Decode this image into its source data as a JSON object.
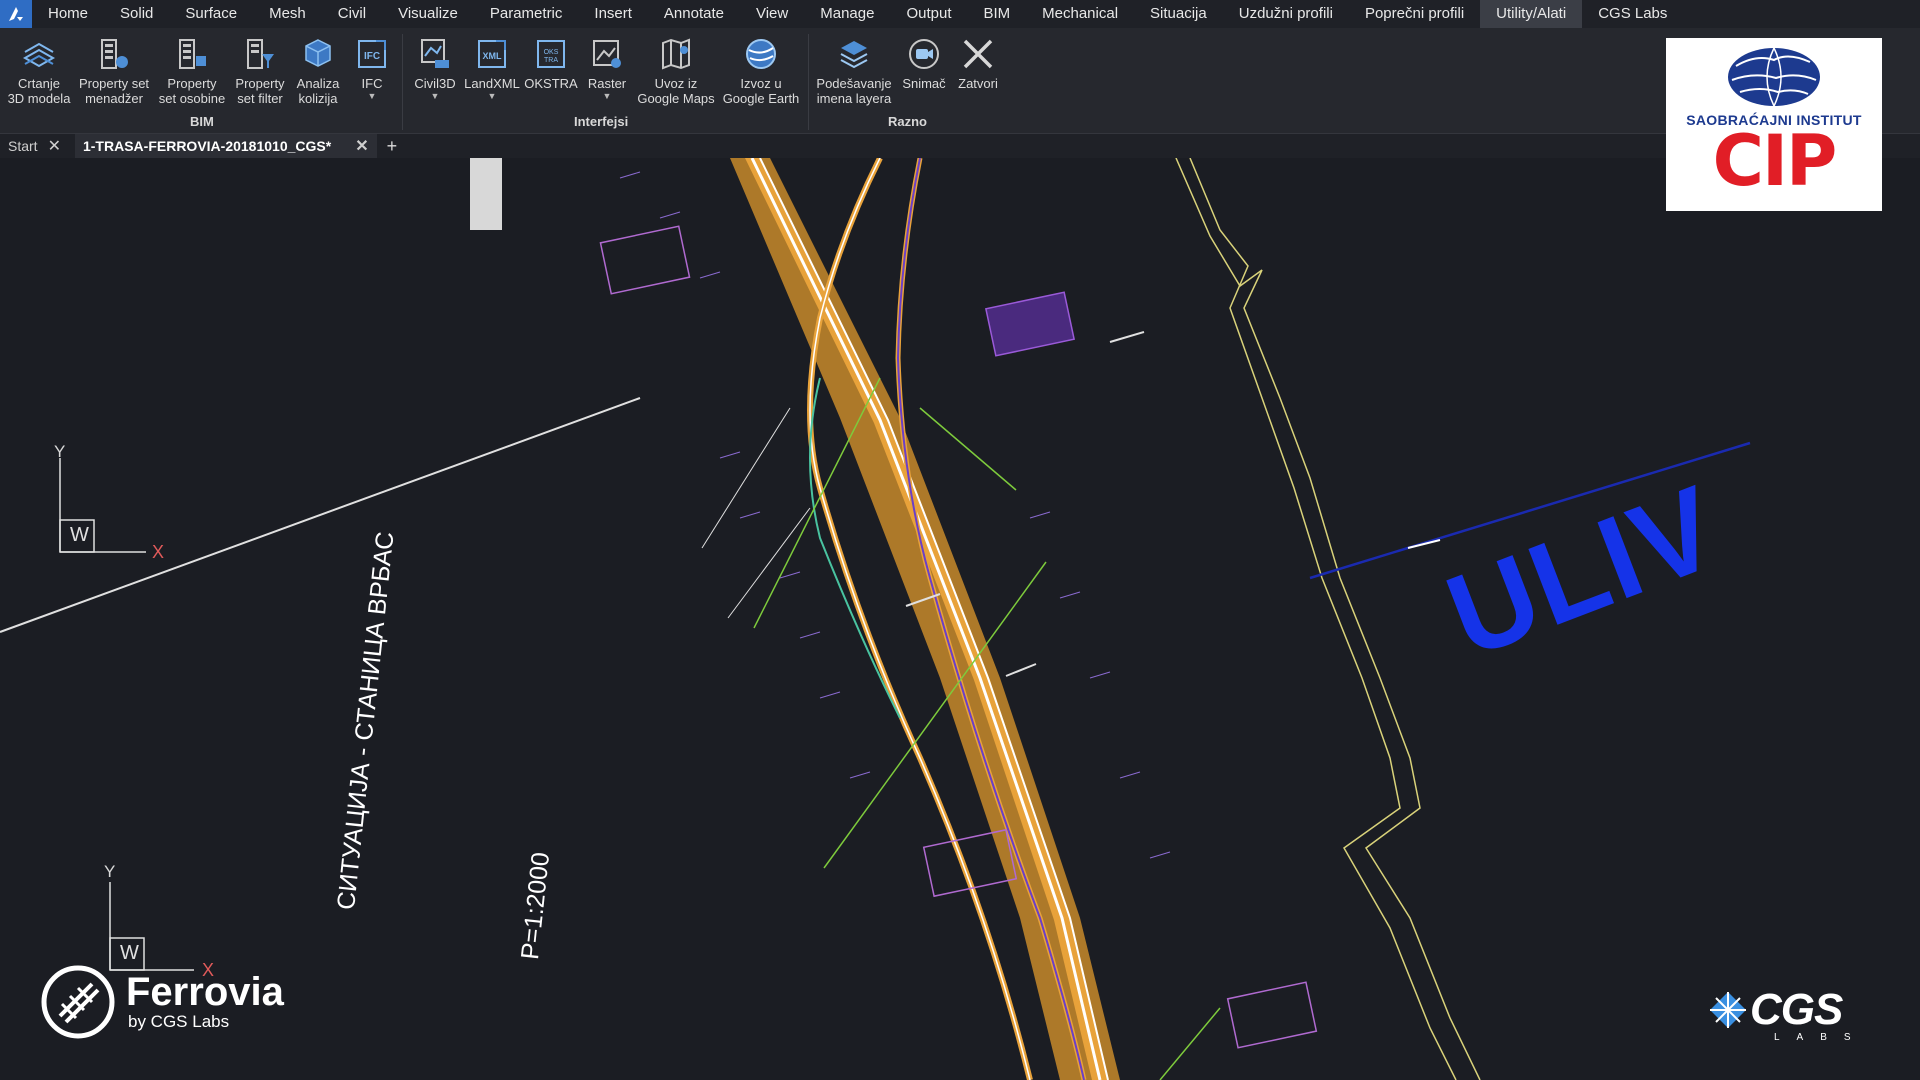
{
  "menu": {
    "items": [
      "Home",
      "Solid",
      "Surface",
      "Mesh",
      "Civil",
      "Visualize",
      "Parametric",
      "Insert",
      "Annotate",
      "View",
      "Manage",
      "Output",
      "BIM",
      "Mechanical",
      "Situacija",
      "Uzdužni profili",
      "Poprečni profili",
      "Utility/Alati",
      "CGS Labs"
    ],
    "active": "Utility/Alati"
  },
  "ribbon": {
    "tools": [
      {
        "id": "crtanje",
        "label": "Crtanje\n3D modela",
        "icon": "3d-model-icon"
      },
      {
        "id": "psm",
        "label": "Property set\nmenadžer",
        "icon": "property-set-manager-icon"
      },
      {
        "id": "pso",
        "label": "Property\nset osobine",
        "icon": "property-set-properties-icon"
      },
      {
        "id": "psf",
        "label": "Property\nset filter",
        "icon": "property-set-filter-icon"
      },
      {
        "id": "ak",
        "label": "Analiza\nkolizija",
        "icon": "collision-analysis-icon"
      },
      {
        "id": "ifc",
        "label": "IFC",
        "icon": "ifc-icon",
        "dropdown": true
      },
      {
        "id": "civil3d",
        "label": "Civil3D",
        "icon": "civil3d-icon",
        "dropdown": true
      },
      {
        "id": "landxml",
        "label": "LandXML",
        "icon": "landxml-icon",
        "dropdown": true
      },
      {
        "id": "okstra",
        "label": "OKSTRA",
        "icon": "okstra-icon"
      },
      {
        "id": "raster",
        "label": "Raster",
        "icon": "raster-icon",
        "dropdown": true
      },
      {
        "id": "gmaps",
        "label": "Uvoz iz\nGoogle Maps",
        "icon": "google-maps-import-icon"
      },
      {
        "id": "gearth",
        "label": "Izvoz u\nGoogle Earth",
        "icon": "google-earth-export-icon"
      },
      {
        "id": "layers",
        "label": "Podešavanje\nimena layera",
        "icon": "layer-names-icon"
      },
      {
        "id": "snimac",
        "label": "Snimač",
        "icon": "recorder-icon"
      },
      {
        "id": "zatvori",
        "label": "Zatvori",
        "icon": "close-icon"
      }
    ],
    "groups": [
      "BIM",
      "Interfejsi",
      "Razno"
    ]
  },
  "tabs": {
    "start": "Start",
    "document": "1-TRASA-FERROVIA-20181010_CGS*"
  },
  "drawing": {
    "uliv": "ULIV",
    "title": "СИТУАЦИЈА - СТАНИЦА ВРБАС",
    "scale": "Р=1:2000",
    "ucs_x": "X",
    "ucs_y": "Y",
    "ucs_w": "W",
    "colors": {
      "track": "#e8a23a",
      "rail": "#ffffff",
      "green": "#7ecb3c",
      "purple": "#7b3fc7",
      "yellow": "#d9d27a",
      "blue": "#1533e8"
    }
  },
  "logos": {
    "cip_sub": "SAOBRAĆAJNI INSTITUT",
    "cip": "CIP",
    "ferrovia": "Ferrovia",
    "ferrovia_by": "by CGS Labs",
    "cgs": "CGS",
    "cgs_labs": "LABS"
  }
}
